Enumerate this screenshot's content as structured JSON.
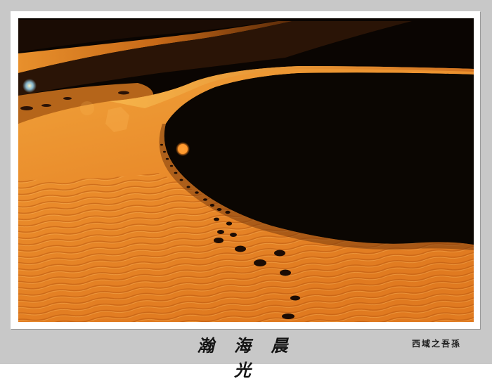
{
  "photo": {
    "subject": "desert-sand-dunes-with-footprints",
    "colors": {
      "sand_light": "#f3a93c",
      "sand_mid": "#e8882a",
      "sand_deep": "#c2570c",
      "shadow": "#0a0502",
      "flare": "#ff8a20"
    }
  },
  "caption": {
    "title": "瀚 海 晨 光",
    "signature": "西域之吾孫"
  }
}
